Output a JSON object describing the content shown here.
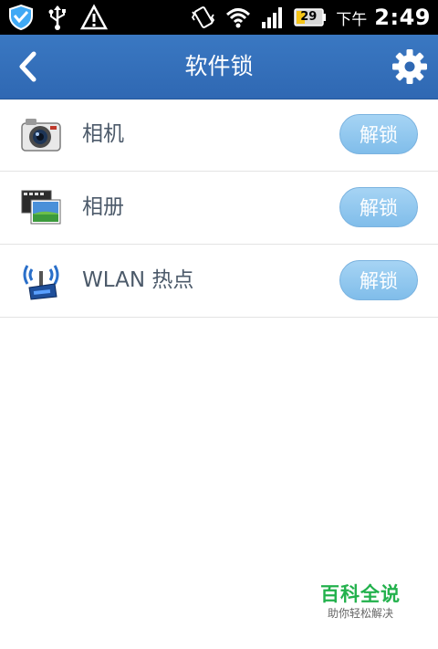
{
  "status_bar": {
    "battery_level": "29",
    "time_period": "下午",
    "time": "2:49",
    "icons": [
      "shield-icon",
      "usb-icon",
      "warning-icon",
      "vibrate-icon",
      "wifi-icon",
      "signal-icon",
      "battery-icon"
    ]
  },
  "header": {
    "title": "软件锁",
    "back_icon": "back-chevron-icon",
    "settings_icon": "gear-icon"
  },
  "apps": [
    {
      "name": "相机",
      "icon": "camera-icon",
      "action": "解锁"
    },
    {
      "name": "相册",
      "icon": "gallery-icon",
      "action": "解锁"
    },
    {
      "name": "WLAN 热点",
      "icon": "wlan-hotspot-icon",
      "action": "解锁"
    }
  ],
  "watermark": {
    "main": "百科全说",
    "sub": "助你轻松解决"
  },
  "colors": {
    "title_bar": "#2f68b3",
    "unlock_button": "#8ec8f0",
    "watermark": "#22b14c"
  }
}
